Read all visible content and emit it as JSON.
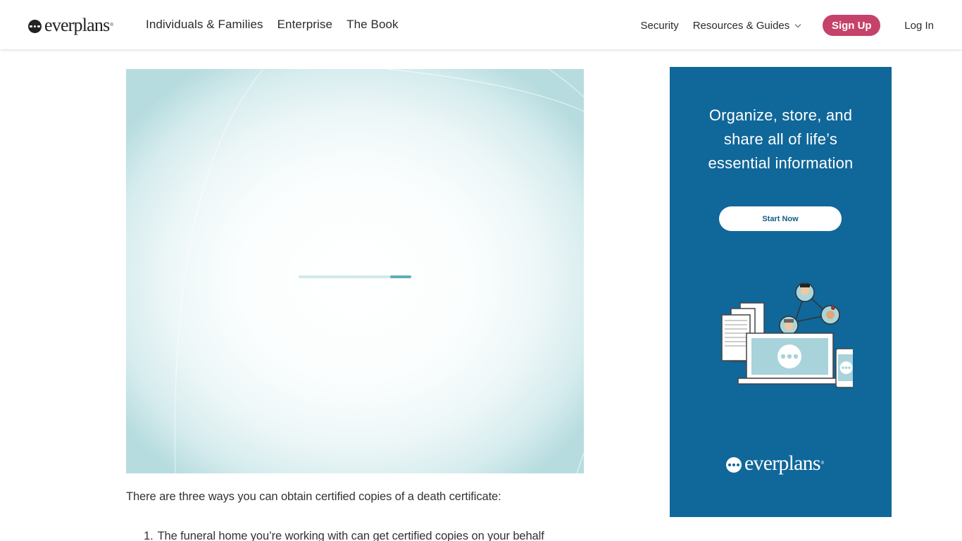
{
  "header": {
    "logo_text": "everplans",
    "logo_reg": "®",
    "nav_left": [
      "Individuals & Families",
      "Enterprise",
      "The Book"
    ],
    "nav_security": "Security",
    "nav_resources": "Resources & Guides",
    "signup_label": "Sign Up",
    "login_label": "Log In"
  },
  "video": {
    "loading_progress_start": 0.81,
    "loading_progress_end": 1.0
  },
  "article": {
    "intro": "There are three ways you can obtain certified copies of a death certificate:",
    "list": [
      {
        "num": "1.",
        "text": "The funeral home you’re working with can get certified copies on your behalf"
      }
    ]
  },
  "ad": {
    "headline_lines": [
      "Organize, store, and",
      "share all of life’s",
      "essential information"
    ],
    "cta_label": "Start Now",
    "logo_text": "everplans",
    "logo_reg": "®"
  },
  "colors": {
    "brand_pink": "#c5426a",
    "ad_blue": "#10679a",
    "loader_fill": "#62aeb2"
  }
}
